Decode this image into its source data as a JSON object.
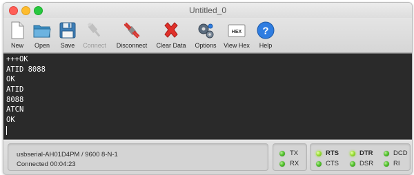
{
  "window": {
    "title": "Untitled_0"
  },
  "toolbar": {
    "new_label": "New",
    "open_label": "Open",
    "save_label": "Save",
    "connect_label": "Connect",
    "disconnect_label": "Disconnect",
    "clear_label": "Clear Data",
    "options_label": "Options",
    "viewhex_label": "View Hex",
    "help_label": "Help",
    "hex_icon_text": "HEX",
    "help_icon_text": "?"
  },
  "console": {
    "lines": [
      "+++OK",
      "ATID 8088",
      "OK",
      "ATID",
      "8088",
      "ATCN",
      "OK"
    ]
  },
  "status": {
    "port_info": "usbserial-AH01D4PM / 9600 8-N-1",
    "connection": "Connected 00:04:23",
    "tx": "TX",
    "rx": "RX",
    "rts": "RTS",
    "cts": "CTS",
    "dtr": "DTR",
    "dsr": "DSR",
    "dcd": "DCD",
    "ri": "RI"
  },
  "colors": {
    "console_bg": "#2a2a2a",
    "console_text": "#ffffff",
    "led_green": "#55c22f",
    "led_bright": "#9ee03a",
    "clear_red": "#e0302a",
    "help_blue": "#2f7de1"
  },
  "icons": [
    "document-icon",
    "folder-icon",
    "floppy-disk-icon",
    "usb-plug-icon",
    "disconnect-plug-icon",
    "red-x-icon",
    "gears-icon",
    "hex-icon",
    "question-icon"
  ]
}
